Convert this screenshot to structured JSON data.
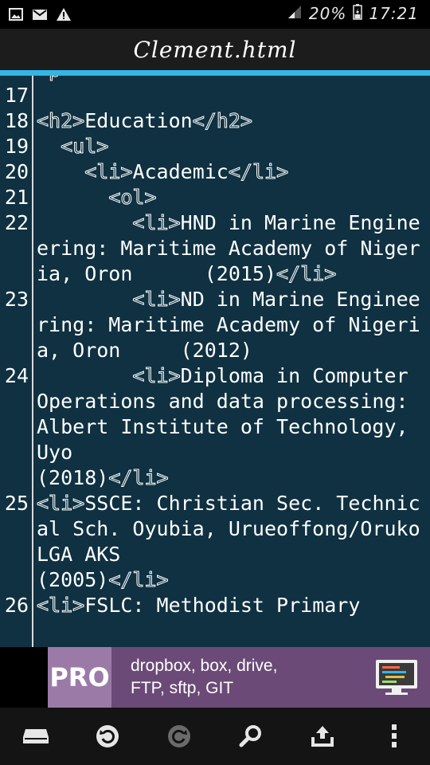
{
  "status_bar": {
    "battery_percent": "20%",
    "time": "17:21",
    "left_icons": [
      "image-icon",
      "mail-icon",
      "warning-icon"
    ]
  },
  "title_bar": {
    "title": "Clement.html"
  },
  "editor": {
    "lines": [
      {
        "num": "",
        "text": "<p"
      },
      {
        "num": "17",
        "text": ""
      },
      {
        "num": "18",
        "text": "<h2>Education</h2>"
      },
      {
        "num": "19",
        "text": "  <ul>"
      },
      {
        "num": "20",
        "text": "    <li>Academic</li>"
      },
      {
        "num": "21",
        "text": "      <ol>"
      },
      {
        "num": "22",
        "text": "        <li>HND in Marine Engineering: Maritime Academy of Nigeria, Oron      (2015)</li>"
      },
      {
        "num": "23",
        "text": "        <li>ND in Marine Engineering: Maritime Academy of Nigeria, Oron     (2012)"
      },
      {
        "num": "24",
        "text": "        <li>Diploma in Computer Operations and data processing: Albert Institute of Technology, Uyo\n(2018)</li>"
      },
      {
        "num": "25",
        "text": "<li>SSCE: Christian Sec. Technical Sch. Oyubia, Urueoffong/Oruko LGA AKS\n(2005)</li>"
      },
      {
        "num": "26",
        "text": "<li>FSLC: Methodist Primary"
      }
    ]
  },
  "ad_banner": {
    "badge": "PRO",
    "line1": "dropbox, box, drive,",
    "line2": "FTP, sftp, GIT"
  },
  "colors": {
    "editor_bg": "#0f3142",
    "accent": "#33b5e5",
    "ad_bg": "#6b4a77"
  },
  "toolbar": {
    "buttons": [
      "storage-icon",
      "undo-icon",
      "redo-icon",
      "search-icon",
      "upload-icon",
      "more-vert-icon"
    ]
  }
}
